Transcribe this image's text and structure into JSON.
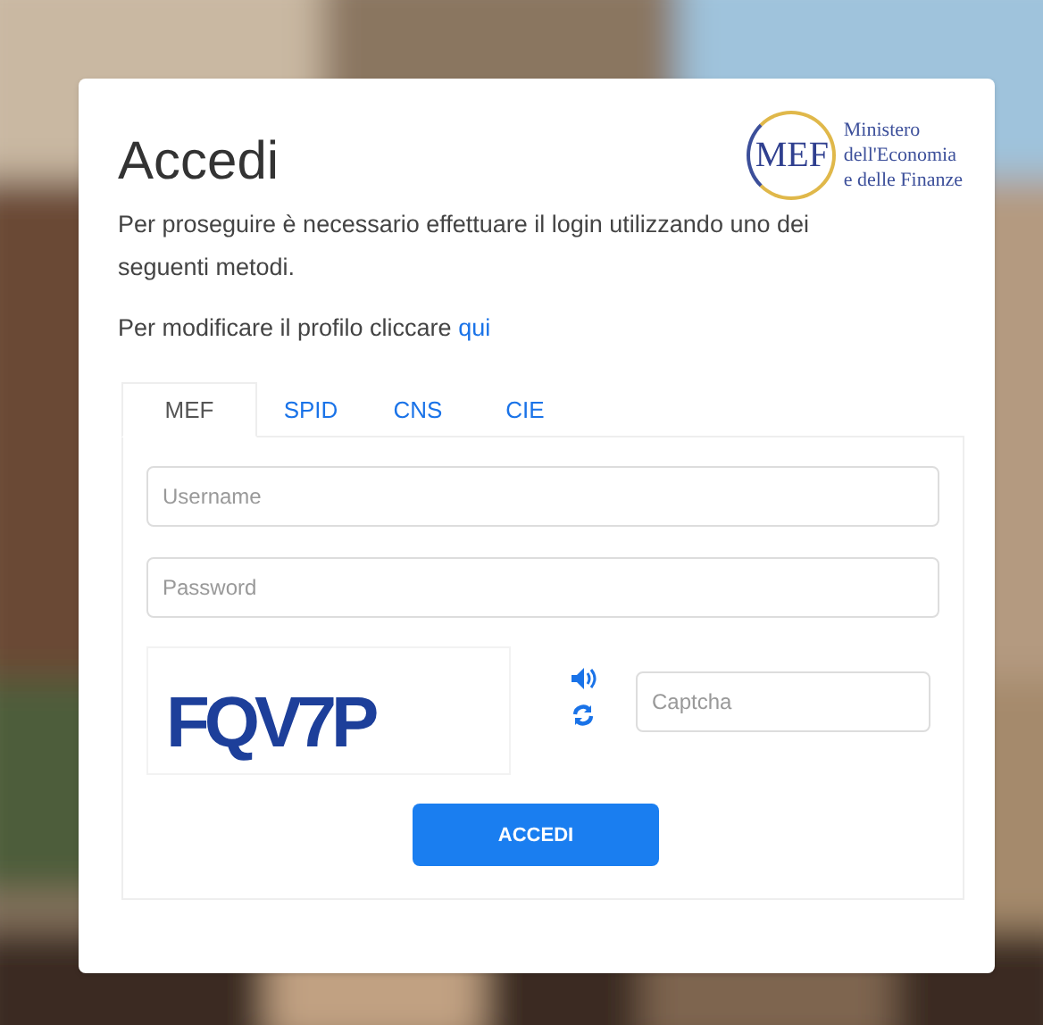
{
  "title": "Accedi",
  "logo": {
    "mark": "MEF",
    "lines": [
      "Ministero",
      "dell'Economia",
      "e delle Finanze"
    ]
  },
  "intro": "Per proseguire è necessario effettuare il login utilizzando uno dei seguenti metodi.",
  "profile_text": "Per modificare il profilo cliccare",
  "profile_link": "qui",
  "tabs": [
    {
      "label": "MEF",
      "selected": true
    },
    {
      "label": "SPID",
      "selected": false
    },
    {
      "label": "CNS",
      "selected": false
    },
    {
      "label": "CIE",
      "selected": false
    }
  ],
  "username": {
    "placeholder": "Username"
  },
  "password": {
    "placeholder": "Password"
  },
  "captcha_image": "FQV7P",
  "captcha": {
    "placeholder": "Captcha"
  },
  "submit": "ACCEDI"
}
